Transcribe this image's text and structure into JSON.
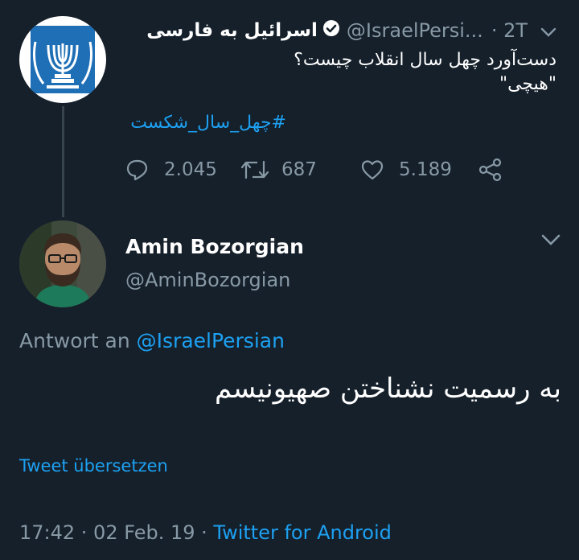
{
  "tweet1": {
    "display_name": "اسرائیل به فارسی",
    "handle": "@IsraelPersi...",
    "time": "· 2T",
    "lines": [
      "دست‌آورد چهل سال انقلاب چیست؟",
      "\"هیچی\""
    ],
    "hashtag": "#چهل_سال_شکست",
    "replies": "2.045",
    "retweets": "687",
    "likes": "5.189"
  },
  "tweet2": {
    "display_name": "Amin Bozorgian",
    "handle": "@AminBozorgian",
    "reply_prefix": "Antwort an",
    "reply_handle": "@IsraelPersian",
    "text": "به رسمیت نشناختن صهیونیسم",
    "translate": "Tweet übersetzen",
    "timestamp": "17:42 · 02 Feb. 19 ·",
    "source": "Twitter for Android"
  },
  "colors": {
    "background": "#15202b",
    "accent": "#1da1f2",
    "muted": "#8899a6",
    "thread_line": "#38444d"
  }
}
